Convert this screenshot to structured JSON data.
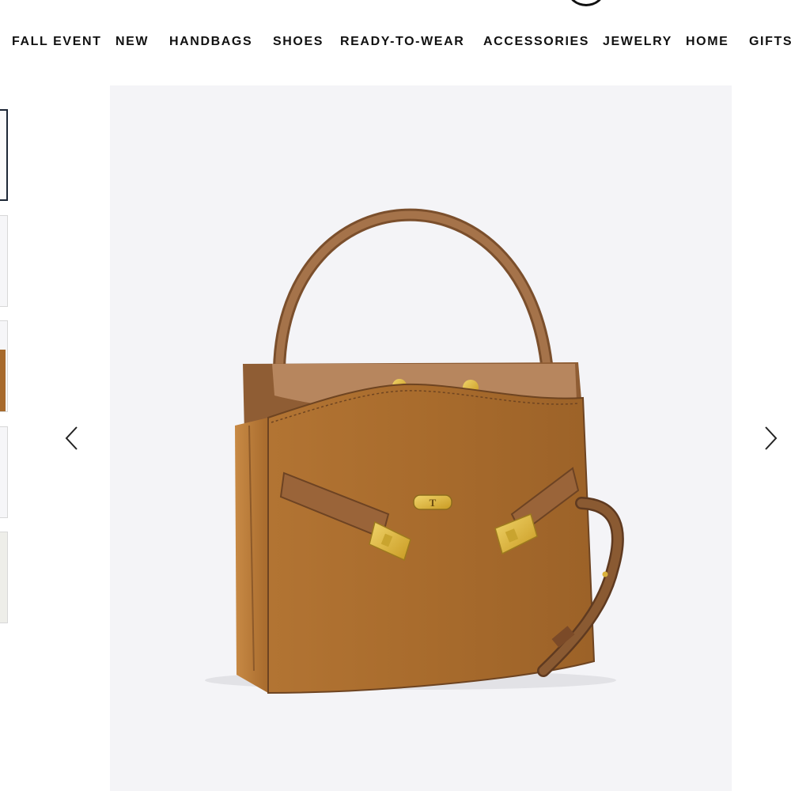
{
  "nav": {
    "items": [
      {
        "id": "fall-event",
        "label": "FALL EVENT"
      },
      {
        "id": "new",
        "label": "NEW"
      },
      {
        "id": "handbags",
        "label": "HANDBAGS"
      },
      {
        "id": "shoes",
        "label": "SHOES"
      },
      {
        "id": "ready-to-wear",
        "label": "READY-TO-WEAR"
      },
      {
        "id": "accessories",
        "label": "ACCESSORIES"
      },
      {
        "id": "jewelry",
        "label": "JEWELRY"
      },
      {
        "id": "home",
        "label": "HOME"
      },
      {
        "id": "gifts",
        "label": "GIFTS"
      }
    ]
  },
  "gallery": {
    "thumbnail_count": 5,
    "active_thumbnail": 1,
    "prev_icon": "chevron-left-icon",
    "next_icon": "chevron-right-icon"
  },
  "product_image": {
    "hardware_monogram": "T"
  },
  "colors": {
    "bag_leather": "#a86b2e",
    "strap_leather": "#8a5a32",
    "hardware_gold": "#d9b13a",
    "stage_background": "#f4f4f7",
    "active_thumb_border": "#1d2735"
  }
}
